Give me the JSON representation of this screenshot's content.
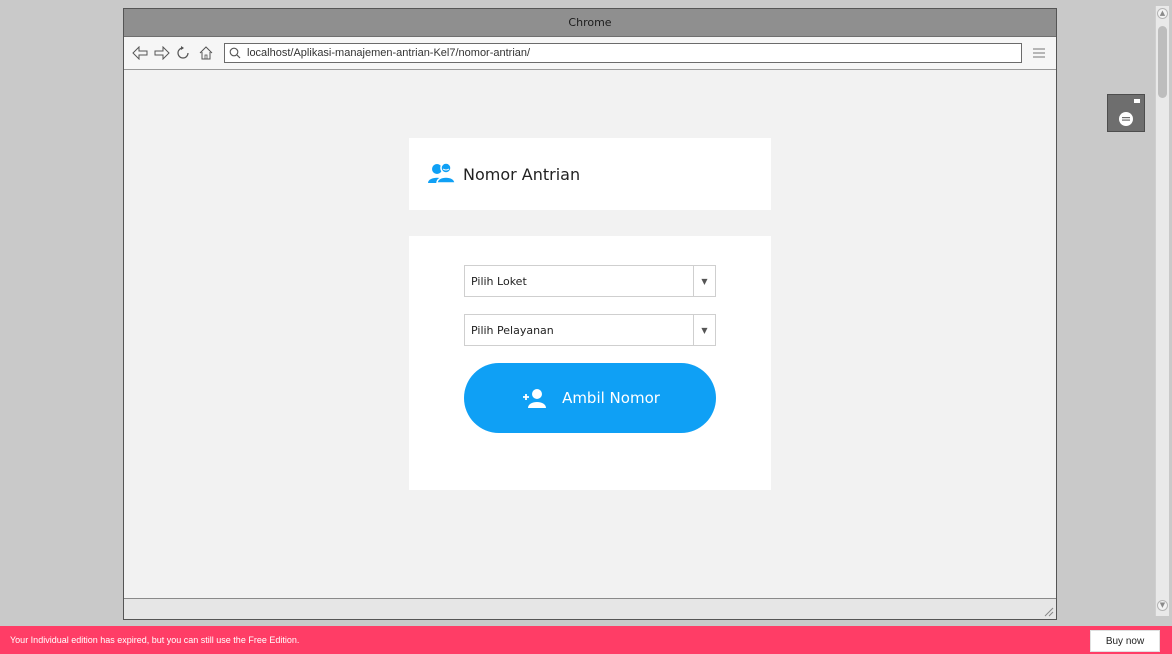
{
  "window": {
    "title": "Chrome"
  },
  "toolbar": {
    "url": "localhost/Aplikasi-manajemen-antrian-Kel7/nomor-antrian/"
  },
  "page": {
    "header": {
      "title": "Nomor Antrian"
    },
    "form": {
      "loket_select": {
        "selected": "Pilih Loket"
      },
      "pelayanan_select": {
        "selected": "Pilih Pelayanan"
      },
      "submit_label": "Ambil Nomor"
    }
  },
  "notice": {
    "message": "Your Individual edition has expired, but you can still use the Free Edition.",
    "buy_label": "Buy now"
  },
  "colors": {
    "accent": "#0fa0f5",
    "notice_bg": "#ff3d66"
  }
}
